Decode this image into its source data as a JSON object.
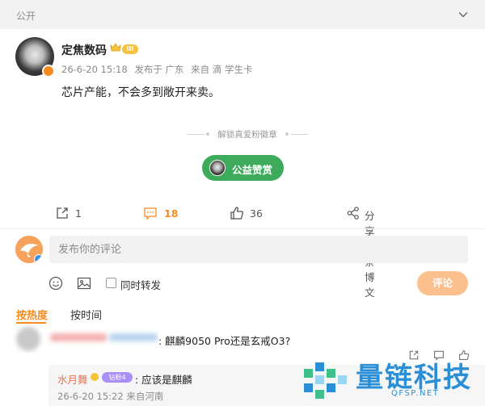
{
  "topbar": {
    "visibility_label": "公开",
    "icon": "chevron-down-icon"
  },
  "post": {
    "author_name": "定焦数码",
    "author_badge_icon": "crown-icon",
    "author_level": "III",
    "meta": {
      "time": "26-6-20 15:18",
      "location": "发布于 广东",
      "source": "来自 滴 学生卡"
    },
    "text": "芯片产能，不会多到敞开来卖。"
  },
  "tip": {
    "unlock_text": "解锁真爱粉徽章",
    "button_label": "公益赞赏"
  },
  "actions": {
    "repost_count": "1",
    "comment_count": "18",
    "like_count": "36",
    "share_label": "分享这条博文"
  },
  "composer": {
    "placeholder": "发布你的评论",
    "repost_option_label": "同时转发",
    "submit_label": "评论"
  },
  "sort": {
    "hot_label": "按热度",
    "time_label": "按时间"
  },
  "comment": {
    "text": ": 麒麟9050 Pro还是玄戒O3?"
  },
  "reply": {
    "name": "水月舞",
    "badge": "钻粉4",
    "text": ": 应该是麒麟",
    "meta": "26-6-20 15:22 来自河南"
  },
  "watermark": {
    "title": "量链科技",
    "domain": "QFSP.NET"
  },
  "colors": {
    "accent": "#f78b1f",
    "tip_green": "#3eaa5b",
    "reply_name": "#eb7350",
    "watermark": "#2a8fd6"
  }
}
